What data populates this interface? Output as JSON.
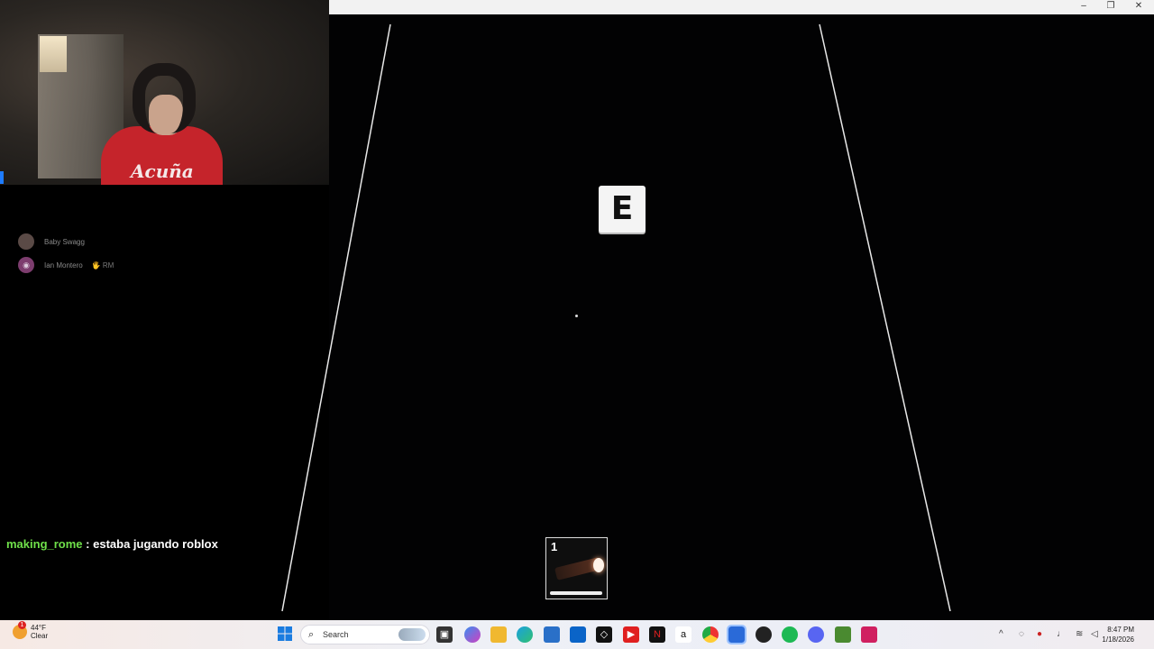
{
  "webcam": {
    "shirt_text": "Acuña"
  },
  "game": {
    "prompt_key": "E",
    "hotbar": [
      {
        "slot_number": "1",
        "item": "flashlight-icon"
      }
    ]
  },
  "window_controls": {
    "minimize": "–",
    "restore": "❐",
    "close": "✕"
  },
  "voice_overlay": {
    "users": [
      {
        "name": "Baby Swagg",
        "tag": ""
      },
      {
        "name": "Ian Montero",
        "tag": "🖐 RM"
      }
    ]
  },
  "chat": {
    "username": "making_rome",
    "separator": " : ",
    "message": "estaba jugando roblox"
  },
  "taskbar": {
    "weather": {
      "temp": "44°F",
      "condition": "Clear",
      "badge": "1"
    },
    "search_placeholder": "Search",
    "clock": {
      "time": "8:47 PM",
      "date": "1/18/2026"
    },
    "pinned_apps": [
      "start-icon",
      "file-explorer-icon",
      "copilot-icon",
      "folder-icon",
      "edge-icon",
      "store-icon",
      "outlook-icon",
      "roblox-icon",
      "youtube-icon",
      "netflix-icon",
      "amazon-icon",
      "chrome-icon",
      "active-app-icon",
      "obs-icon",
      "spotify-icon",
      "discord-icon",
      "minecraft-icon",
      "app-icon"
    ]
  }
}
